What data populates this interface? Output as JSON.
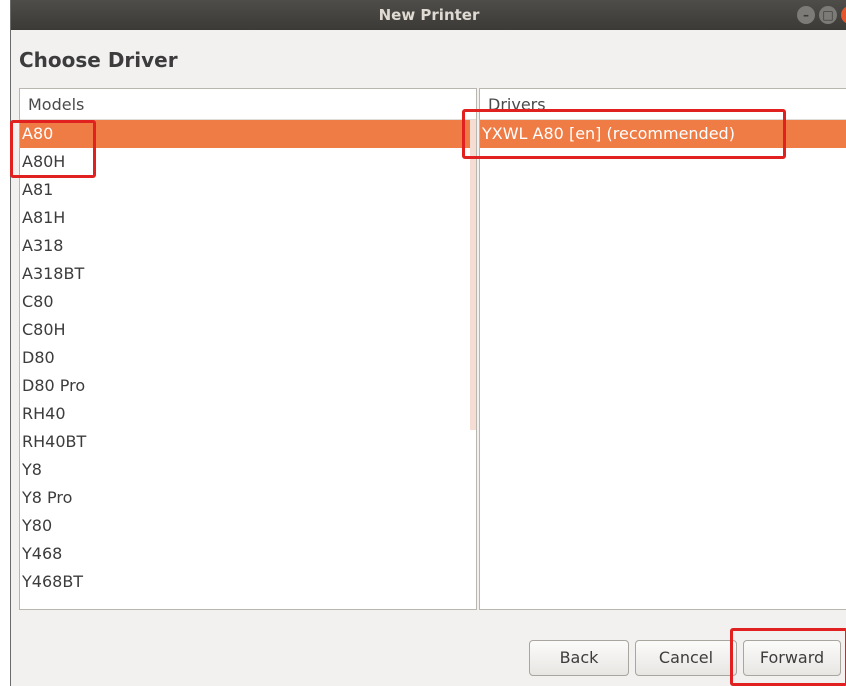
{
  "window": {
    "title": "New Printer"
  },
  "page": {
    "heading": "Choose Driver"
  },
  "models": {
    "header": "Models",
    "items": [
      "A80",
      "A80H",
      "A81",
      "A81H",
      "A318",
      "A318BT",
      "C80",
      "C80H",
      "D80",
      "D80 Pro",
      "RH40",
      "RH40BT",
      "Y8",
      "Y8 Pro",
      "Y80",
      "Y468",
      "Y468BT"
    ],
    "selected": "A80"
  },
  "drivers": {
    "header": "Drivers",
    "items": [
      "YXWL A80 [en] (recommended)"
    ],
    "selected": "YXWL A80 [en] (recommended)"
  },
  "buttons": {
    "back": "Back",
    "cancel": "Cancel",
    "forward": "Forward"
  },
  "colors": {
    "selection": "#ef7b45",
    "annotation": "#e12020"
  }
}
